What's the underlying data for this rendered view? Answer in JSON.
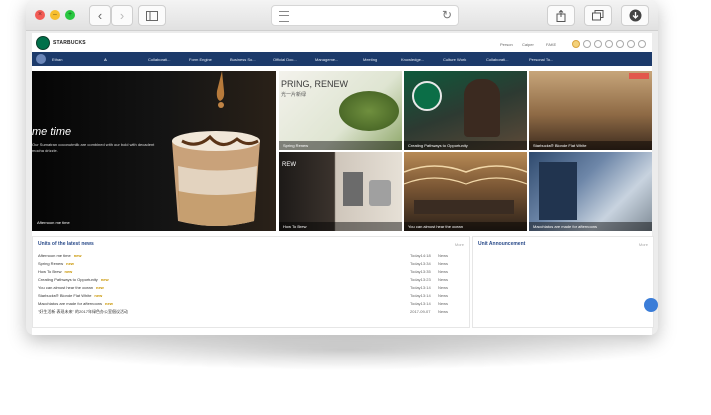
{
  "site": {
    "brand": "STARBUCKS",
    "top_links": [
      "Person",
      "Caiper",
      "FAKE"
    ]
  },
  "nav": {
    "user": "Ethan",
    "items": [
      "Collaborati...",
      "Form Engine",
      "Business So...",
      "Official Doc...",
      "Manageme...",
      "Meeting",
      "Knowledge...",
      "Culture Work",
      "Collaborati...",
      "Personal To..."
    ]
  },
  "hero": {
    "headline": "me time",
    "body": "Our Sumatran coconutmilk are combined with our bold with decadent mocha drizzle.",
    "caption": "Afternoon me time"
  },
  "tiles": [
    {
      "caption": "Spring Renew",
      "overlay": "PRING, RENEW",
      "overlay_sub": "光一片新绿"
    },
    {
      "caption": "Creating Pathways to Opportunity"
    },
    {
      "caption": "Starbucks® Blonde Flat White"
    },
    {
      "caption": "How To Brew",
      "overlay": "REW"
    },
    {
      "caption": "You can almost hear the ocean"
    },
    {
      "caption": "Macchiatos are made for afternoons"
    }
  ],
  "news": {
    "title": "Units of the latest news",
    "more": "More",
    "new_badge": "new",
    "rows": [
      {
        "title": "Afternoon me time",
        "date": "Today14:18",
        "cat": "News"
      },
      {
        "title": "Spring Renew",
        "date": "Today13:34",
        "cat": "News"
      },
      {
        "title": "How To Brew",
        "date": "Today13:35",
        "cat": "News"
      },
      {
        "title": "Creating Pathways to Opportunity",
        "date": "Today13:23",
        "cat": "News"
      },
      {
        "title": "You can almost hear the ocean",
        "date": "Today13:14",
        "cat": "News"
      },
      {
        "title": "Starbucks® Blonde Flat White",
        "date": "Today13:14",
        "cat": "News"
      },
      {
        "title": "Macchiatos are made for afternoons",
        "date": "Today13:14",
        "cat": "News"
      },
      {
        "title": "\"好生活新 表现未来\" 的2017年绿色办公室倡议活动",
        "date": "2017-09-07",
        "cat": "News"
      }
    ]
  },
  "announcement": {
    "title": "Unit Announcement",
    "more": "More"
  },
  "colors": {
    "nav": "#1c3a6a",
    "brand_green": "#00704a",
    "link_blue": "#2a4b8a"
  }
}
